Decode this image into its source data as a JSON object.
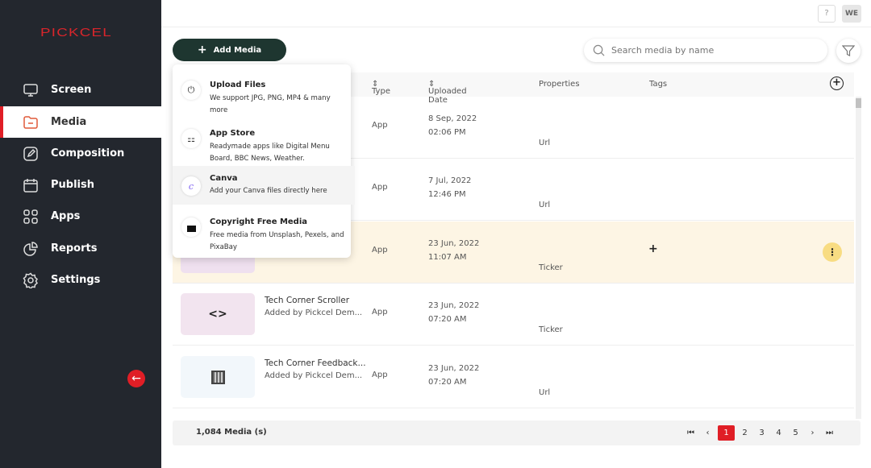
{
  "sidebar": {
    "logo": "PICKCEL",
    "items": [
      {
        "label": "Screen",
        "icon": "monitor-icon"
      },
      {
        "label": "Media",
        "icon": "folder-icon",
        "active": true
      },
      {
        "label": "Composition",
        "icon": "edit-icon"
      },
      {
        "label": "Publish",
        "icon": "calendar-icon"
      },
      {
        "label": "Apps",
        "icon": "apps-icon"
      },
      {
        "label": "Reports",
        "icon": "pie-chart-icon"
      },
      {
        "label": "Settings",
        "icon": "gear-icon"
      }
    ],
    "collapse_icon": "←"
  },
  "topbar": {
    "help": "?",
    "avatar": "WE"
  },
  "toolbar": {
    "add_media": "Add Media",
    "search_placeholder": "Search media by name"
  },
  "table": {
    "columns": {
      "type": "Type",
      "uploaded": "Uploaded Date",
      "properties": "Properties",
      "tags": "Tags"
    },
    "rows": [
      {
        "type": "App",
        "date": "8 Sep, 2022",
        "time": "02:06 PM",
        "property": "Url"
      },
      {
        "type": "App",
        "date": "7 Jul, 2022",
        "time": "12:46 PM",
        "property": "Url"
      },
      {
        "type": "App",
        "date": "23 Jun, 2022",
        "time": "11:07 AM",
        "property": "Ticker",
        "tag_add": "+",
        "highlighted": true
      },
      {
        "name": "Tech Corner Scroller",
        "added_by": "Added by Pickcel Dem...",
        "type": "App",
        "date": "23 Jun, 2022",
        "time": "07:20 AM",
        "property": "Ticker"
      },
      {
        "name": "Tech Corner Feedback...",
        "added_by": "Added by Pickcel Dem...",
        "type": "App",
        "date": "23 Jun, 2022",
        "time": "07:20 AM",
        "property": "Url"
      }
    ]
  },
  "footer": {
    "count": "1,084 Media (s)",
    "pages": [
      "1",
      "2",
      "3",
      "4",
      "5"
    ],
    "current_page": "1"
  },
  "add_menu": [
    {
      "title": "Upload Files",
      "desc": "We support JPG, PNG, MP4 & many more",
      "icon": "upload-icon"
    },
    {
      "title": "App Store",
      "desc": "Readymade apps like Digital Menu Board, BBC News, Weather.",
      "icon": "apps-icon"
    },
    {
      "title": "Canva",
      "desc": "Add your Canva files directly here",
      "icon": "canva-icon"
    },
    {
      "title": "Copyright Free Media",
      "desc": "Free media from Unsplash, Pexels, and PixaBay",
      "icon": "free-media-icon"
    }
  ],
  "colors": {
    "sidebar": "#23272e",
    "accent": "#e01e26",
    "add_button": "#1e3630",
    "highlight_row": "#fdf5e4"
  }
}
